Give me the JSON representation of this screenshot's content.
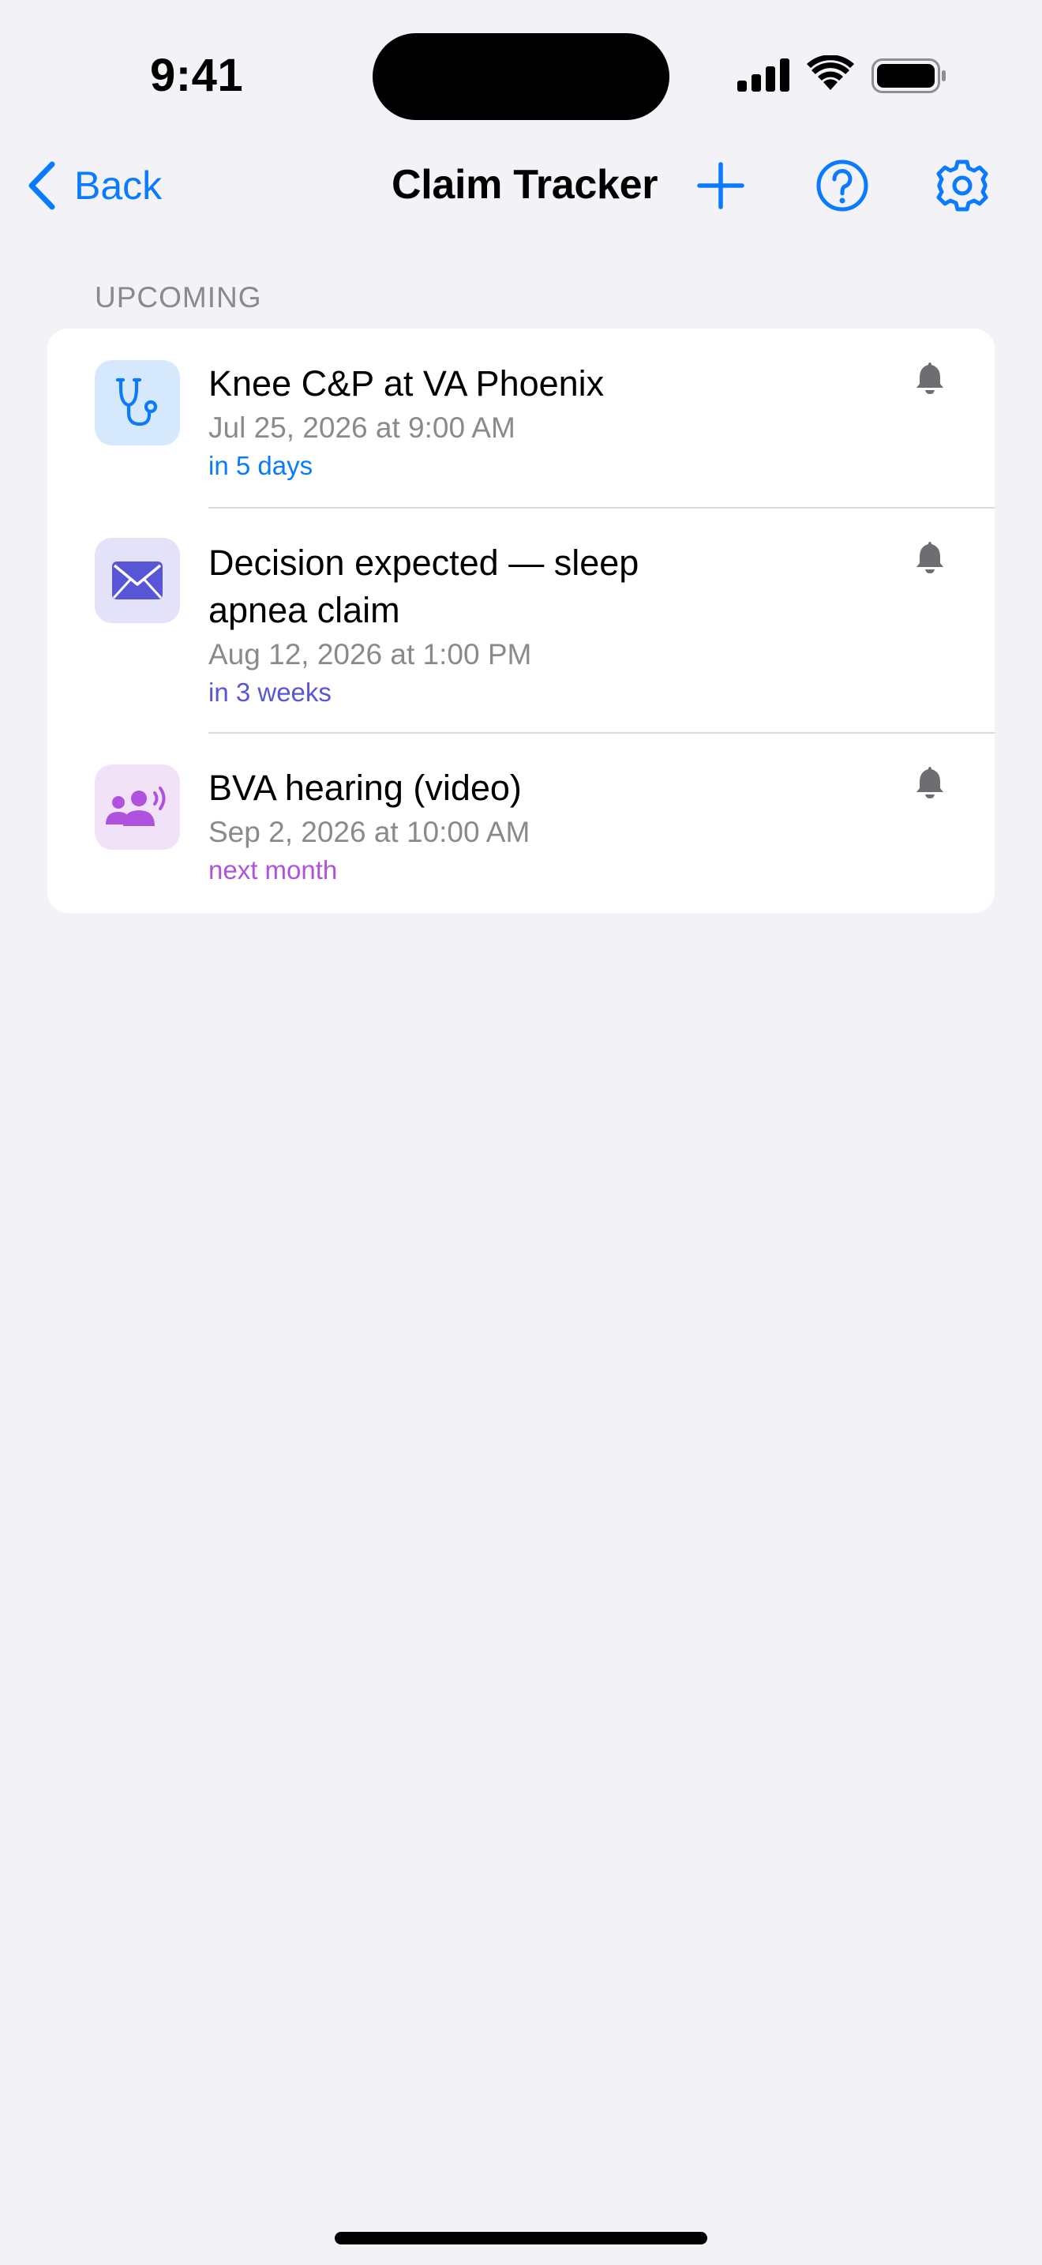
{
  "status_bar": {
    "time": "9:41",
    "icons": [
      "signal-icon",
      "wifi-icon",
      "battery-icon"
    ]
  },
  "nav": {
    "back_label": "Back",
    "title": "Claim Tracker",
    "actions": [
      "add-icon",
      "help-icon",
      "gear-icon"
    ]
  },
  "colors": {
    "accent": "#0A7AFF",
    "indigo": "#5856D6",
    "purple": "#AF52DE",
    "secondary_text": "#8A8A8E",
    "background": "#F2F2F7"
  },
  "upcoming": {
    "header": "UPCOMING",
    "items": [
      {
        "title": "Knee C&P at VA Phoenix",
        "datetime": "Jul 25, 2026 at 9:00 AM",
        "relative": "in 5 days",
        "icon": "stethoscope-icon",
        "alert_icon": "bell-icon"
      },
      {
        "title": "Decision expected — sleep apnea claim",
        "datetime": "Aug 12, 2026 at 1:00 PM",
        "relative": "in 3 weeks",
        "icon": "envelope-icon",
        "alert_icon": "bell-icon"
      },
      {
        "title": "BVA hearing (video)",
        "datetime": "Sep 2, 2026 at 10:00 AM",
        "relative": "next month",
        "icon": "group-speaking-icon",
        "alert_icon": "bell-icon"
      }
    ]
  }
}
